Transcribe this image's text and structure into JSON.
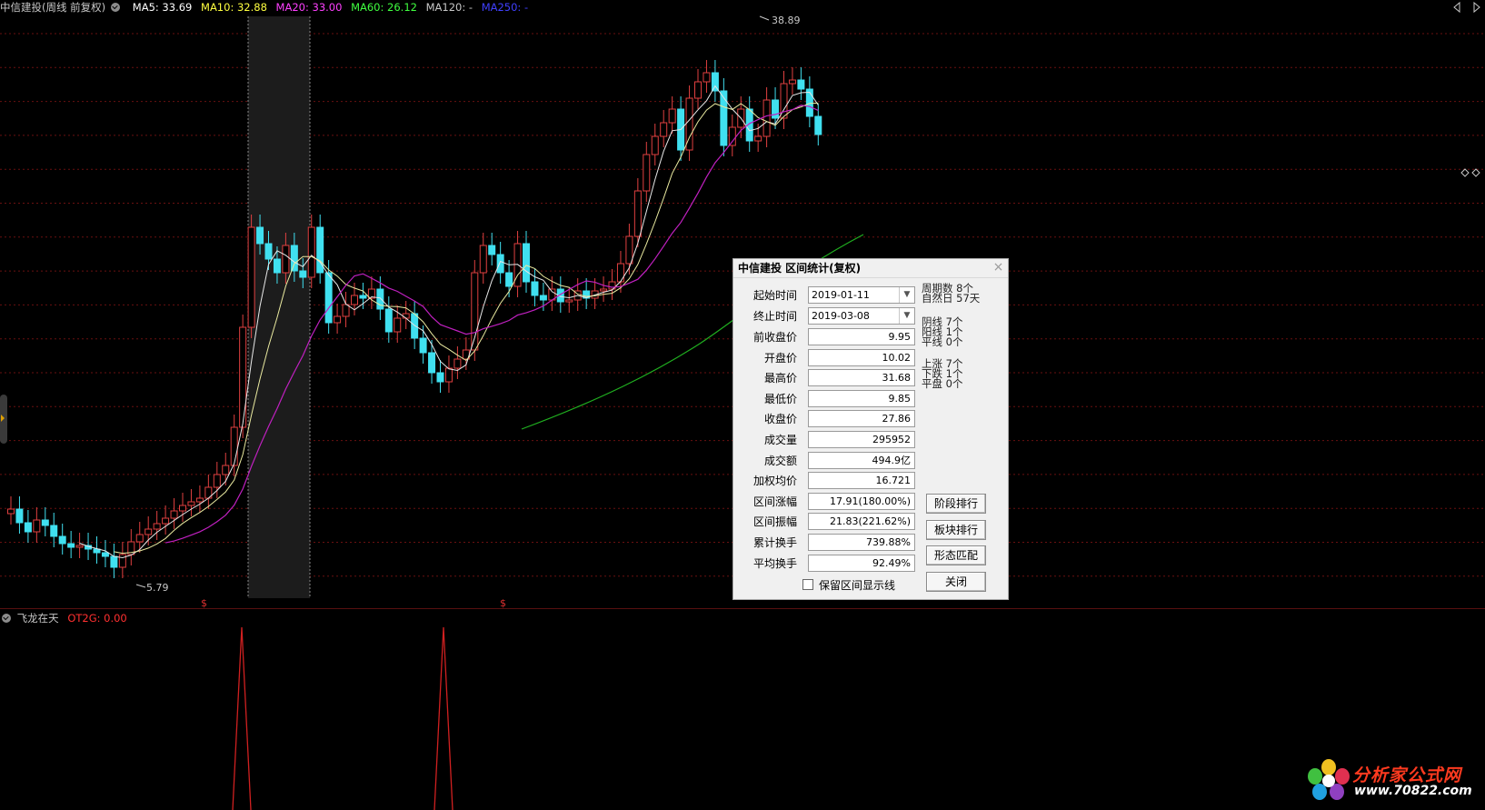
{
  "legend": {
    "stock": "中信建投(周线 前复权)",
    "ma5": "MA5: 33.69",
    "ma10": "MA10: 32.88",
    "ma20": "MA20: 33.00",
    "ma60": "MA60: 26.12",
    "ma120": "MA120: -",
    "ma250": "MA250: -",
    "colors": {
      "stock": "#c8c8c8",
      "ma5": "#ffffff",
      "ma10": "#ffff40",
      "ma20": "#ff40ff",
      "ma60": "#40ff40",
      "ma120": "#c8c8c8",
      "ma250": "#4040ff"
    }
  },
  "price_labels": {
    "high": "38.89",
    "low": "5.79"
  },
  "markers": [
    "$",
    "$"
  ],
  "indicator": {
    "name": "飞龙在天",
    "value": "OT2G: 0.00"
  },
  "dialog": {
    "title": "中信建投 区间统计(复权)",
    "start_label": "起始时间",
    "start_value": "2019-01-11",
    "end_label": "终止时间",
    "end_value": "2019-03-08",
    "fields": [
      {
        "label": "前收盘价",
        "value": "9.95"
      },
      {
        "label": "开盘价",
        "value": "10.02"
      },
      {
        "label": "最高价",
        "value": "31.68"
      },
      {
        "label": "最低价",
        "value": "9.85"
      },
      {
        "label": "收盘价",
        "value": "27.86"
      },
      {
        "label": "成交量",
        "value": "295952"
      },
      {
        "label": "成交额",
        "value": "494.9亿"
      },
      {
        "label": "加权均价",
        "value": "16.721"
      },
      {
        "label": "区间涨幅",
        "value": "17.91(180.00%)"
      },
      {
        "label": "区间振幅",
        "value": "21.83(221.62%)"
      },
      {
        "label": "累计换手",
        "value": "739.88%"
      },
      {
        "label": "平均换手",
        "value": "92.49%"
      }
    ],
    "stats": {
      "periods": "周期数  8个",
      "natural_days": "自然日  57天",
      "yin": "阴线  7个",
      "yang": "阳线  1个",
      "flat": "平线  0个",
      "up": "上涨  7个",
      "down": "下跌  1个",
      "level": "平盘  0个"
    },
    "buttons": {
      "stage_rank": "阶段排行",
      "sector_rank": "板块排行",
      "pattern_match": "形态匹配",
      "close": "关闭"
    },
    "keep_lines": "保留区间显示线"
  },
  "watermark": {
    "text": "分析家公式网",
    "url": "www.70822.com"
  }
}
